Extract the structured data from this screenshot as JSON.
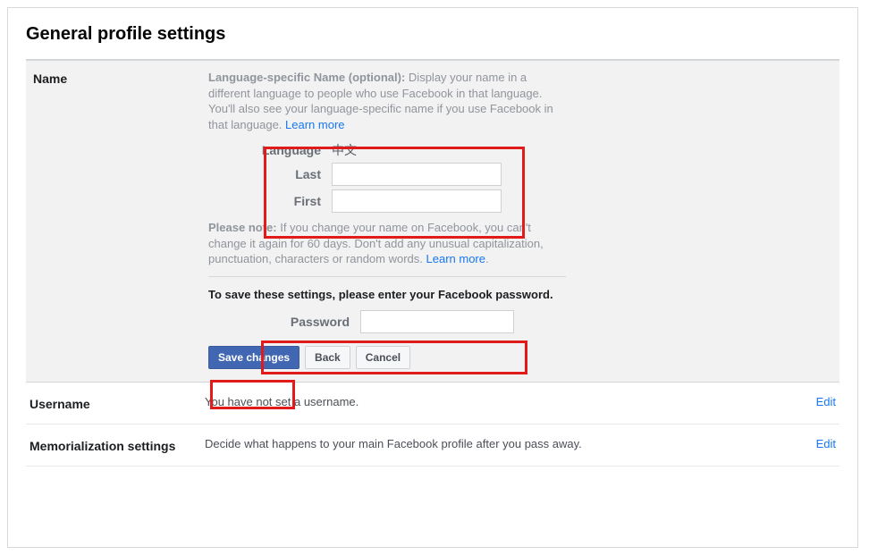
{
  "page": {
    "title": "General profile settings"
  },
  "nameSection": {
    "header": "Name",
    "langDesc_bold": "Language-specific Name (optional): ",
    "langDesc_rest": "Display your name in a different language to people who use Facebook in that language. You'll also see your language-specific name if you use Facebook in that language. ",
    "learnMore": "Learn more",
    "form": {
      "languageLabel": "Language",
      "languageValue": "中文",
      "lastLabel": "Last",
      "lastValue": "",
      "firstLabel": "First",
      "firstValue": ""
    },
    "note_bold": "Please note: ",
    "note_rest": "If you change your name on Facebook, you can't change it again for 60 days. Don't add any unusual capitalization, punctuation, characters or random words. ",
    "noteLearnMore": "Learn more",
    "savePrompt": "To save these settings, please enter your Facebook password.",
    "passwordLabel": "Password",
    "passwordValue": "",
    "buttons": {
      "save": "Save changes",
      "back": "Back",
      "cancel": "Cancel"
    }
  },
  "usernameSection": {
    "header": "Username",
    "desc": "You have not set a username.",
    "edit": "Edit"
  },
  "memorializationSection": {
    "header": "Memorialization settings",
    "desc": "Decide what happens to your main Facebook profile after you pass away.",
    "edit": "Edit"
  }
}
